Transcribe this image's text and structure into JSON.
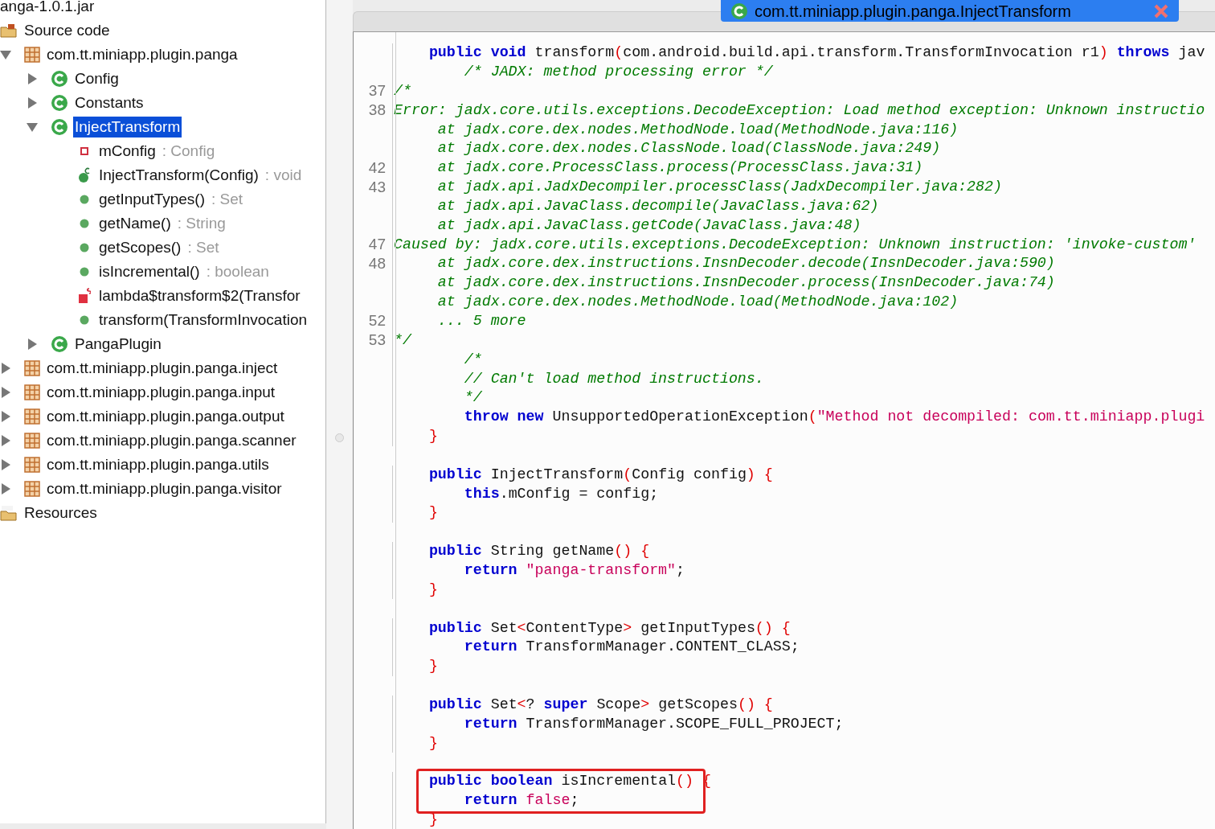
{
  "tree": [
    {
      "label": "anga-1.0.1.jar",
      "kind": "jar",
      "children": [
        {
          "label": "Source code",
          "kind": "source",
          "children": [
            {
              "label": "com.tt.miniapp.plugin.panga",
              "kind": "package",
              "expanded": true,
              "selected": false,
              "children": [
                {
                  "label": "Config",
                  "kind": "class",
                  "expanded": false,
                  "selected": false
                },
                {
                  "label": "Constants",
                  "kind": "class",
                  "expanded": false,
                  "selected": false
                },
                {
                  "label": "InjectTransform",
                  "kind": "class",
                  "expanded": true,
                  "selected": true,
                  "children": [
                    {
                      "label": "mConfig",
                      "type": ": Config",
                      "kind": "field",
                      "selected": false
                    },
                    {
                      "label": "InjectTransform(Config)",
                      "type": ": void",
                      "kind": "constructor",
                      "selected": false
                    },
                    {
                      "label": "getInputTypes()",
                      "type": ": Set",
                      "kind": "method",
                      "selected": false
                    },
                    {
                      "label": "getName()",
                      "type": ": String",
                      "kind": "method",
                      "selected": false
                    },
                    {
                      "label": "getScopes()",
                      "type": ": Set",
                      "kind": "method",
                      "selected": false
                    },
                    {
                      "label": "isIncremental()",
                      "type": ": boolean",
                      "kind": "method",
                      "selected": false
                    },
                    {
                      "label": "lambda$transform$2(Transfor",
                      "kind": "static-method",
                      "selected": false
                    },
                    {
                      "label": "transform(TransformInvocation",
                      "kind": "method",
                      "selected": false
                    }
                  ]
                },
                {
                  "label": "PangaPlugin",
                  "kind": "class",
                  "expanded": false,
                  "selected": false
                }
              ]
            },
            {
              "label": "com.tt.miniapp.plugin.panga.inject",
              "kind": "package",
              "expanded": false,
              "selected": false
            },
            {
              "label": "com.tt.miniapp.plugin.panga.input",
              "kind": "package",
              "expanded": false,
              "selected": false
            },
            {
              "label": "com.tt.miniapp.plugin.panga.output",
              "kind": "package",
              "expanded": false,
              "selected": false
            },
            {
              "label": "com.tt.miniapp.plugin.panga.scanner",
              "kind": "package",
              "expanded": false,
              "selected": false
            },
            {
              "label": "com.tt.miniapp.plugin.panga.utils",
              "kind": "package",
              "expanded": false,
              "selected": false
            },
            {
              "label": "com.tt.miniapp.plugin.panga.visitor",
              "kind": "package",
              "expanded": false,
              "selected": false
            }
          ]
        },
        {
          "label": "Resources",
          "kind": "resources"
        }
      ]
    }
  ],
  "tabs": [
    {
      "title": "com.tt.miniapp.plugin.panga.InjectTransform",
      "selected": true
    }
  ],
  "code": [
    {
      "kind": "code",
      "tokens": [
        {
          "kind": "kw",
          "text": "    public void "
        },
        {
          "kind": "plain",
          "text": "transform"
        },
        {
          "kind": "punct",
          "text": "("
        },
        {
          "kind": "plain",
          "text": "com.android.build.api.transform.TransformInvocation r1"
        },
        {
          "kind": "punct",
          "text": ")"
        },
        {
          "kind": "kw",
          "text": " throws "
        },
        {
          "kind": "plain",
          "text": "jav"
        }
      ]
    },
    {
      "kind": "code",
      "tokens": [
        {
          "kind": "comment",
          "text": "        /* JADX: method processing error */"
        }
      ]
    },
    {
      "kind": "code",
      "num": "37",
      "tokens": [
        {
          "kind": "comment",
          "text": "/*"
        }
      ]
    },
    {
      "kind": "code",
      "num": "38",
      "tokens": [
        {
          "kind": "comment",
          "text": "Error: jadx.core.utils.exceptions.DecodeException: Load method exception: Unknown instructio"
        }
      ]
    },
    {
      "kind": "code",
      "tokens": [
        {
          "kind": "comment",
          "text": "     at jadx.core.dex.nodes.MethodNode.load(MethodNode.java:116)"
        }
      ]
    },
    {
      "kind": "code",
      "tokens": [
        {
          "kind": "comment",
          "text": "     at jadx.core.dex.nodes.ClassNode.load(ClassNode.java:249)"
        }
      ]
    },
    {
      "kind": "code",
      "num": "42",
      "tokens": [
        {
          "kind": "comment",
          "text": "     at jadx.core.ProcessClass.process(ProcessClass.java:31)"
        }
      ]
    },
    {
      "kind": "code",
      "num": "43",
      "tokens": [
        {
          "kind": "comment",
          "text": "     at jadx.api.JadxDecompiler.processClass(JadxDecompiler.java:282)"
        }
      ]
    },
    {
      "kind": "code",
      "tokens": [
        {
          "kind": "comment",
          "text": "     at jadx.api.JavaClass.decompile(JavaClass.java:62)"
        }
      ]
    },
    {
      "kind": "code",
      "tokens": [
        {
          "kind": "comment",
          "text": "     at jadx.api.JavaClass.getCode(JavaClass.java:48)"
        }
      ]
    },
    {
      "kind": "code",
      "num": "47",
      "tokens": [
        {
          "kind": "comment",
          "text": "Caused by: jadx.core.utils.exceptions.DecodeException: Unknown instruction: 'invoke-custom'"
        }
      ]
    },
    {
      "kind": "code",
      "num": "48",
      "tokens": [
        {
          "kind": "comment",
          "text": "     at jadx.core.dex.instructions.InsnDecoder.decode(InsnDecoder.java:590)"
        }
      ]
    },
    {
      "kind": "code",
      "tokens": [
        {
          "kind": "comment",
          "text": "     at jadx.core.dex.instructions.InsnDecoder.process(InsnDecoder.java:74)"
        }
      ]
    },
    {
      "kind": "code",
      "tokens": [
        {
          "kind": "comment",
          "text": "     at jadx.core.dex.nodes.MethodNode.load(MethodNode.java:102)"
        }
      ]
    },
    {
      "kind": "code",
      "num": "52",
      "tokens": [
        {
          "kind": "comment",
          "text": "     ... 5 more"
        }
      ]
    },
    {
      "kind": "code",
      "num": "53",
      "tokens": [
        {
          "kind": "comment",
          "text": "*/"
        }
      ]
    },
    {
      "kind": "code",
      "tokens": [
        {
          "kind": "comment",
          "text": "        /*"
        }
      ]
    },
    {
      "kind": "code",
      "tokens": [
        {
          "kind": "comment",
          "text": "        // Can't load method instructions."
        }
      ]
    },
    {
      "kind": "code",
      "tokens": [
        {
          "kind": "comment",
          "text": "        */"
        }
      ]
    },
    {
      "kind": "code",
      "tokens": [
        {
          "kind": "kw",
          "text": "        throw new "
        },
        {
          "kind": "plain",
          "text": "UnsupportedOperationException"
        },
        {
          "kind": "punct",
          "text": "("
        },
        {
          "kind": "str",
          "text": "\"Method not decompiled: com.tt.miniapp.plugi"
        }
      ]
    },
    {
      "kind": "code",
      "tokens": [
        {
          "kind": "punct",
          "text": "    }"
        }
      ]
    },
    {
      "kind": "blank"
    },
    {
      "kind": "code",
      "tokens": [
        {
          "kind": "kw",
          "text": "    public "
        },
        {
          "kind": "plain",
          "text": "InjectTransform"
        },
        {
          "kind": "punct",
          "text": "("
        },
        {
          "kind": "plain",
          "text": "Config config"
        },
        {
          "kind": "punct",
          "text": ") {"
        }
      ]
    },
    {
      "kind": "code",
      "tokens": [
        {
          "kind": "kw",
          "text": "        this"
        },
        {
          "kind": "plain",
          "text": ".mConfig = config;"
        }
      ]
    },
    {
      "kind": "code",
      "tokens": [
        {
          "kind": "punct",
          "text": "    }"
        }
      ]
    },
    {
      "kind": "blank"
    },
    {
      "kind": "code",
      "tokens": [
        {
          "kind": "kw",
          "text": "    public "
        },
        {
          "kind": "plain",
          "text": "String getName"
        },
        {
          "kind": "punct",
          "text": "() {"
        }
      ]
    },
    {
      "kind": "code",
      "tokens": [
        {
          "kind": "kw",
          "text": "        return "
        },
        {
          "kind": "str",
          "text": "\"panga-transform\""
        },
        {
          "kind": "plain",
          "text": ";"
        }
      ]
    },
    {
      "kind": "code",
      "tokens": [
        {
          "kind": "punct",
          "text": "    }"
        }
      ]
    },
    {
      "kind": "blank"
    },
    {
      "kind": "code",
      "tokens": [
        {
          "kind": "kw",
          "text": "    public "
        },
        {
          "kind": "plain",
          "text": "Set"
        },
        {
          "kind": "punct",
          "text": "<"
        },
        {
          "kind": "plain",
          "text": "ContentType"
        },
        {
          "kind": "punct",
          "text": ">"
        },
        {
          "kind": "plain",
          "text": " getInputTypes"
        },
        {
          "kind": "punct",
          "text": "() {"
        }
      ]
    },
    {
      "kind": "code",
      "tokens": [
        {
          "kind": "kw",
          "text": "        return "
        },
        {
          "kind": "plain",
          "text": "TransformManager.CONTENT_CLASS;"
        }
      ]
    },
    {
      "kind": "code",
      "tokens": [
        {
          "kind": "punct",
          "text": "    }"
        }
      ]
    },
    {
      "kind": "blank"
    },
    {
      "kind": "code",
      "tokens": [
        {
          "kind": "kw",
          "text": "    public "
        },
        {
          "kind": "plain",
          "text": "Set"
        },
        {
          "kind": "punct",
          "text": "<"
        },
        {
          "kind": "plain",
          "text": "? "
        },
        {
          "kind": "kw",
          "text": "super "
        },
        {
          "kind": "plain",
          "text": "Scope"
        },
        {
          "kind": "punct",
          "text": ">"
        },
        {
          "kind": "plain",
          "text": " getScopes"
        },
        {
          "kind": "punct",
          "text": "() {"
        }
      ]
    },
    {
      "kind": "code",
      "tokens": [
        {
          "kind": "kw",
          "text": "        return "
        },
        {
          "kind": "plain",
          "text": "TransformManager.SCOPE_FULL_PROJECT;"
        }
      ]
    },
    {
      "kind": "code",
      "tokens": [
        {
          "kind": "punct",
          "text": "    }"
        }
      ]
    },
    {
      "kind": "blank"
    },
    {
      "kind": "code",
      "highlighted": true,
      "tokens": [
        {
          "kind": "kw",
          "text": "    public boolean "
        },
        {
          "kind": "plain",
          "text": "isIncremental"
        },
        {
          "kind": "punct",
          "text": "() {"
        }
      ]
    },
    {
      "kind": "code",
      "highlighted": true,
      "tokens": [
        {
          "kind": "kw",
          "text": "        return "
        },
        {
          "kind": "str",
          "text": "false"
        },
        {
          "kind": "plain",
          "text": ";"
        }
      ]
    },
    {
      "kind": "code",
      "tokens": [
        {
          "kind": "punct",
          "text": "    }"
        }
      ]
    }
  ]
}
